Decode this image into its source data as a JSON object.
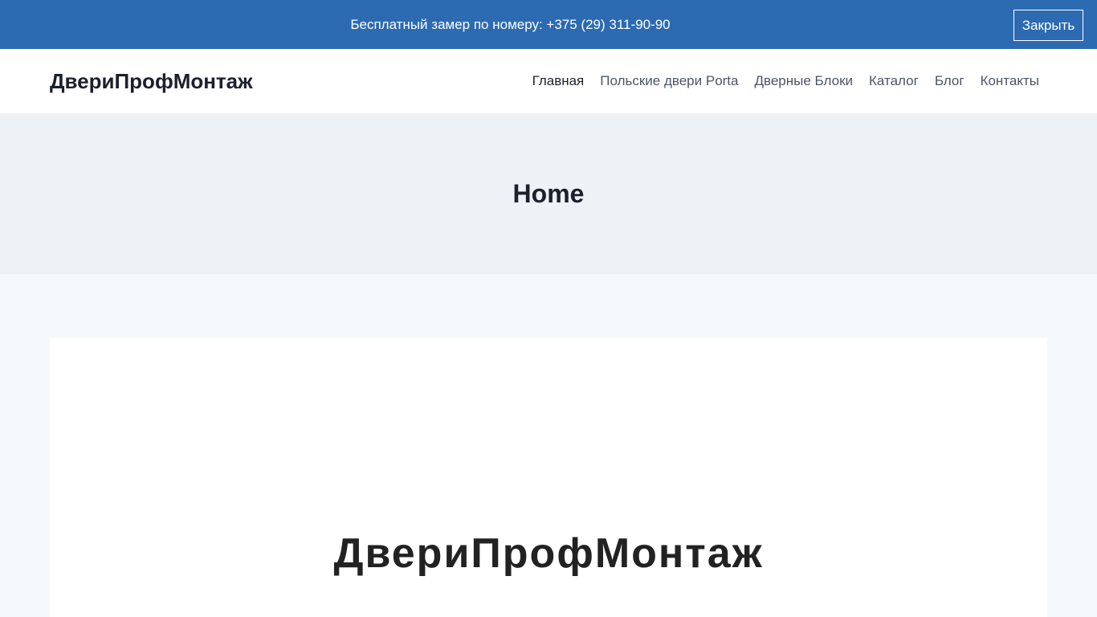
{
  "promo_bar": {
    "text": "Бесплатный замер по номеру: +375 (29) 311-90-90",
    "close_label": "Закрыть"
  },
  "header": {
    "site_title": "ДвериПрофМонтаж",
    "nav": [
      {
        "label": "Главная",
        "active": true
      },
      {
        "label": "Польские двери Porta",
        "active": false
      },
      {
        "label": "Дверные Блоки",
        "active": false
      },
      {
        "label": "Каталог",
        "active": false
      },
      {
        "label": "Блог",
        "active": false
      },
      {
        "label": "Контакты",
        "active": false
      }
    ]
  },
  "hero": {
    "page_title": "Home"
  },
  "content": {
    "heading": "ДвериПрофМонтаж"
  },
  "colors": {
    "promo_bar_bg": "#2c6ab2",
    "hero_bg": "#edf2f7",
    "page_bg": "#f6f9fc",
    "text_dark": "#1a202c",
    "nav_text": "#4a5568"
  }
}
